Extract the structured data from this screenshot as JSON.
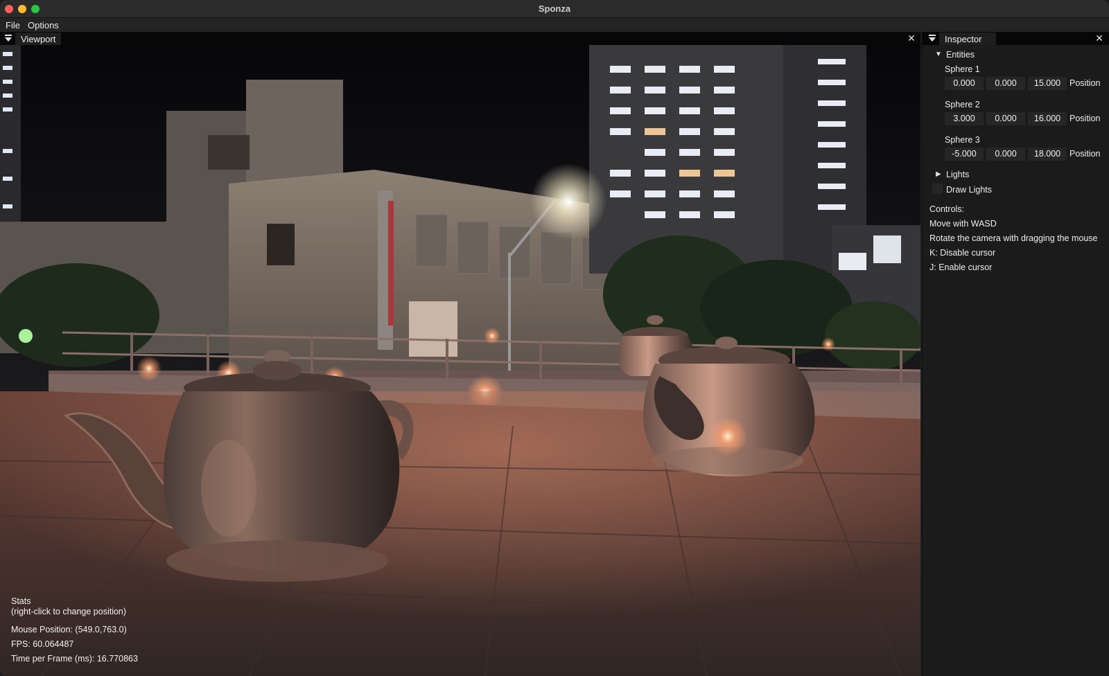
{
  "window": {
    "title": "Sponza"
  },
  "menu": {
    "file": "File",
    "options": "Options"
  },
  "viewport": {
    "tab_label": "Viewport"
  },
  "stats": {
    "title": "Stats",
    "hint": "(right-click to change position)",
    "mouse_position": "Mouse Position: (549.0,763.0)",
    "fps": "FPS: 60.064487",
    "frame_time": "Time per Frame (ms): 16.770863"
  },
  "inspector": {
    "tab_label": "Inspector",
    "entities_label": "Entities",
    "spheres": [
      {
        "name": "Sphere 1",
        "x": "0.000",
        "y": "0.000",
        "z": "15.000",
        "field_label": "Position"
      },
      {
        "name": "Sphere 2",
        "x": "3.000",
        "y": "0.000",
        "z": "16.000",
        "field_label": "Position"
      },
      {
        "name": "Sphere 3",
        "x": "-5.000",
        "y": "0.000",
        "z": "18.000",
        "field_label": "Position"
      }
    ],
    "lights_label": "Lights",
    "draw_lights_label": "Draw Lights",
    "controls": {
      "title": "Controls:",
      "lines": [
        "Move with WASD",
        "Rotate the camera with dragging the mouse",
        "K: Disable cursor",
        "J: Enable cursor"
      ]
    }
  },
  "colors": {
    "titlebar": "#2b2b2b",
    "panel_header": "#070707",
    "panel_bg": "#1b1b1b",
    "field_bg": "#262626"
  }
}
